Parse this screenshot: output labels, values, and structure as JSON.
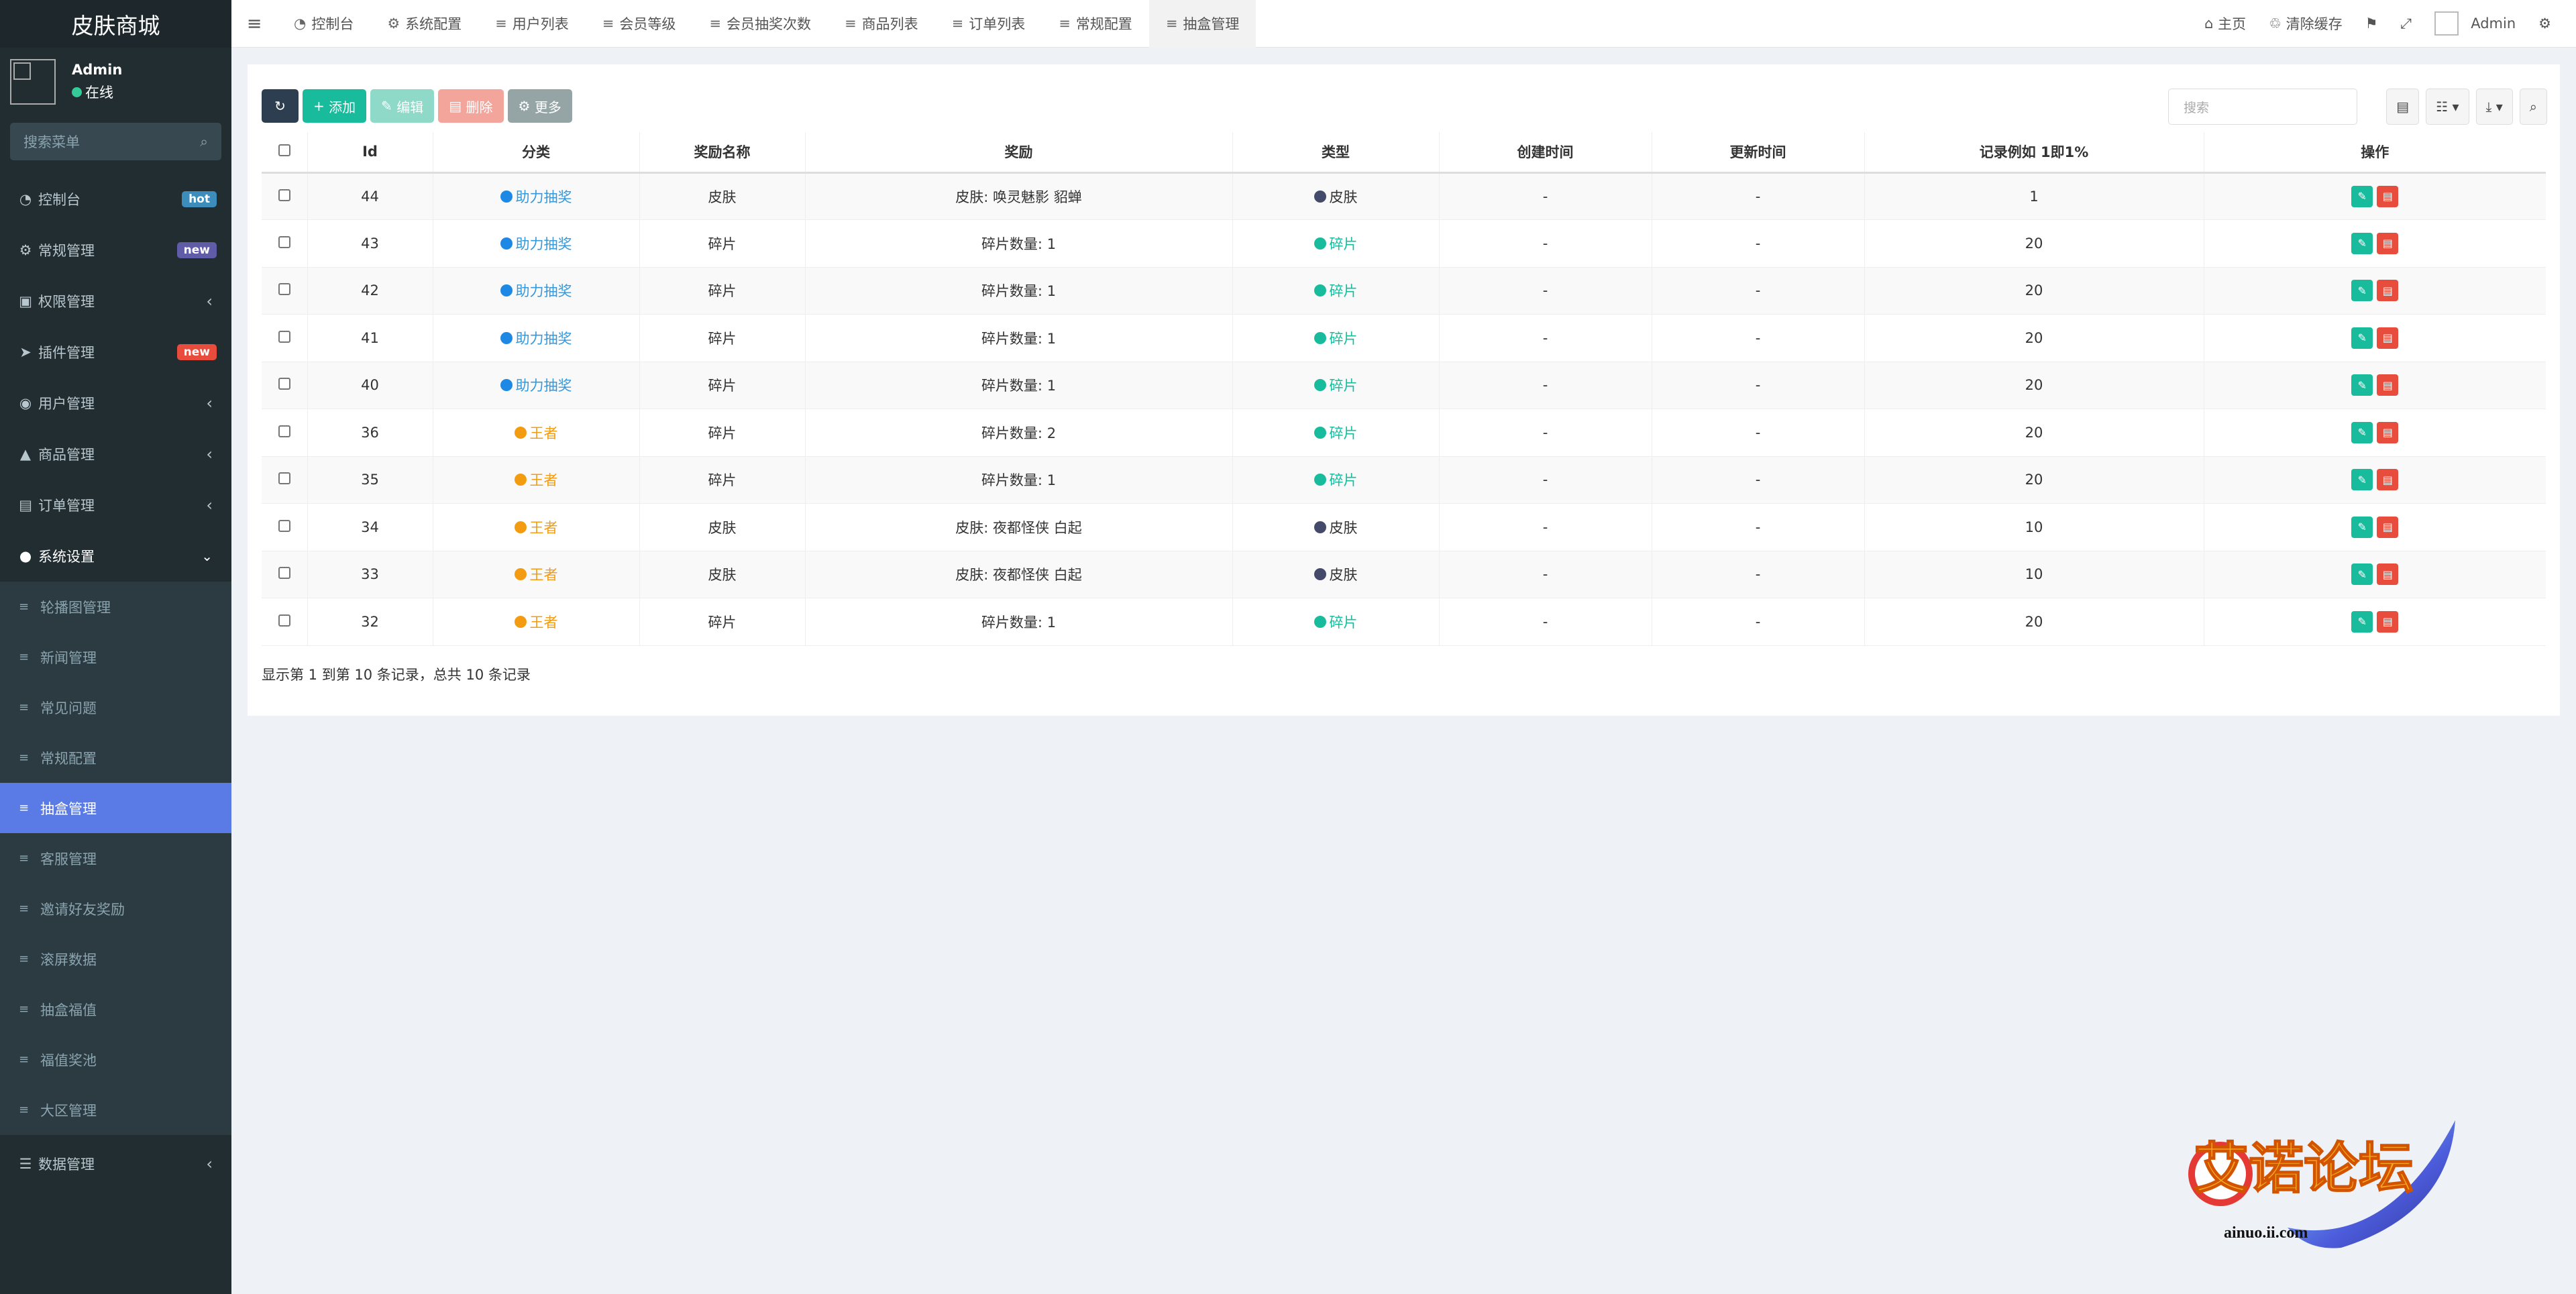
{
  "app": {
    "logo": "皮肤商城"
  },
  "user": {
    "name": "Admin",
    "status": "在线"
  },
  "sidebar": {
    "search_placeholder": "搜索菜单",
    "items": [
      {
        "label": "控制台",
        "badge": "hot",
        "badge_color": "#3c8dbc"
      },
      {
        "label": "常规管理",
        "badge": "new",
        "badge_color": "#605ca8"
      },
      {
        "label": "权限管理"
      },
      {
        "label": "插件管理",
        "badge": "new",
        "badge_color": "#e74c3c"
      },
      {
        "label": "用户管理"
      },
      {
        "label": "商品管理"
      },
      {
        "label": "订单管理"
      },
      {
        "label": "系统设置"
      }
    ],
    "sub_items": [
      "轮播图管理",
      "新闻管理",
      "常见问题",
      "常规配置",
      "抽盒管理",
      "客服管理",
      "邀请好友奖励",
      "滚屏数据",
      "抽盒福值",
      "福值奖池",
      "大区管理"
    ],
    "bottom_item": {
      "label": "数据管理"
    }
  },
  "topbar": {
    "tabs": [
      "控制台",
      "系统配置",
      "用户列表",
      "会员等级",
      "会员抽奖次数",
      "商品列表",
      "订单列表",
      "常规配置",
      "抽盒管理"
    ],
    "home": "主页",
    "clear_cache": "清除缓存",
    "admin": "Admin"
  },
  "toolbar": {
    "add": "添加",
    "edit": "编辑",
    "delete": "删除",
    "more": "更多",
    "search_placeholder": "搜索"
  },
  "table": {
    "headers": [
      "Id",
      "分类",
      "奖励名称",
      "奖励",
      "类型",
      "创建时间",
      "更新时间",
      "记录例如 1即1%",
      "操作"
    ],
    "rows": [
      {
        "id": "44",
        "category": "助力抽奖",
        "cat_color": "blue",
        "name": "皮肤",
        "reward": "皮肤: 唤灵魅影 貂蝉",
        "type": "皮肤",
        "type_color": "dark",
        "created": "-",
        "updated": "-",
        "rate": "1"
      },
      {
        "id": "43",
        "category": "助力抽奖",
        "cat_color": "blue",
        "name": "碎片",
        "reward": "碎片数量: 1",
        "type": "碎片",
        "type_color": "teal",
        "created": "-",
        "updated": "-",
        "rate": "20"
      },
      {
        "id": "42",
        "category": "助力抽奖",
        "cat_color": "blue",
        "name": "碎片",
        "reward": "碎片数量: 1",
        "type": "碎片",
        "type_color": "teal",
        "created": "-",
        "updated": "-",
        "rate": "20"
      },
      {
        "id": "41",
        "category": "助力抽奖",
        "cat_color": "blue",
        "name": "碎片",
        "reward": "碎片数量: 1",
        "type": "碎片",
        "type_color": "teal",
        "created": "-",
        "updated": "-",
        "rate": "20"
      },
      {
        "id": "40",
        "category": "助力抽奖",
        "cat_color": "blue",
        "name": "碎片",
        "reward": "碎片数量: 1",
        "type": "碎片",
        "type_color": "teal",
        "created": "-",
        "updated": "-",
        "rate": "20"
      },
      {
        "id": "36",
        "category": "王者",
        "cat_color": "orange",
        "name": "碎片",
        "reward": "碎片数量: 2",
        "type": "碎片",
        "type_color": "teal",
        "created": "-",
        "updated": "-",
        "rate": "20"
      },
      {
        "id": "35",
        "category": "王者",
        "cat_color": "orange",
        "name": "碎片",
        "reward": "碎片数量: 1",
        "type": "碎片",
        "type_color": "teal",
        "created": "-",
        "updated": "-",
        "rate": "20"
      },
      {
        "id": "34",
        "category": "王者",
        "cat_color": "orange",
        "name": "皮肤",
        "reward": "皮肤: 夜都怪侠 白起",
        "type": "皮肤",
        "type_color": "dark",
        "created": "-",
        "updated": "-",
        "rate": "10"
      },
      {
        "id": "33",
        "category": "王者",
        "cat_color": "orange",
        "name": "皮肤",
        "reward": "皮肤: 夜都怪侠 白起",
        "type": "皮肤",
        "type_color": "dark",
        "created": "-",
        "updated": "-",
        "rate": "10"
      },
      {
        "id": "32",
        "category": "王者",
        "cat_color": "orange",
        "name": "碎片",
        "reward": "碎片数量: 1",
        "type": "碎片",
        "type_color": "teal",
        "created": "-",
        "updated": "-",
        "rate": "20"
      }
    ]
  },
  "footer": {
    "info": "显示第 1 到第 10 条记录，总共 10 条记录"
  },
  "watermark": {
    "text": "艾诺论坛",
    "url": "ainuo.ii.com"
  },
  "colors": {
    "sidebar_bg": "#222d32",
    "active": "#5a7be6",
    "teal": "#18bc9c",
    "danger": "#e74c3c"
  }
}
